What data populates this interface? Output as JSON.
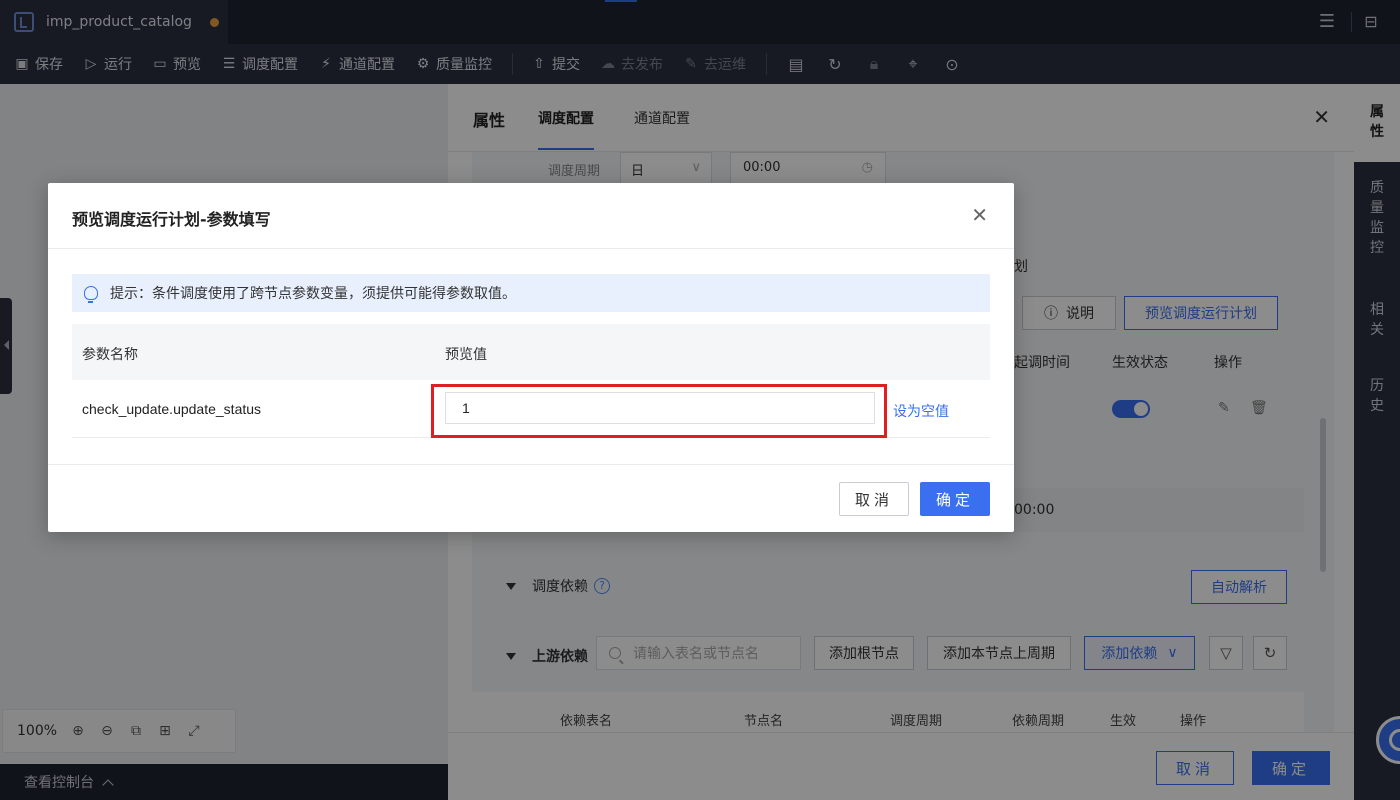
{
  "tabbar": {
    "file_name": "imp_product_catalog"
  },
  "toolbar": {
    "items": [
      {
        "label": "保存",
        "icon": "save-icon"
      },
      {
        "label": "运行",
        "icon": "play-icon"
      },
      {
        "label": "预览",
        "icon": "preview-icon"
      },
      {
        "label": "调度配置",
        "icon": "schedule-icon"
      },
      {
        "label": "通道配置",
        "icon": "channel-icon"
      },
      {
        "label": "质量监控",
        "icon": "monitor-icon"
      },
      {
        "label": "提交",
        "icon": "upload-icon"
      },
      {
        "label": "去发布",
        "icon": "cloud-icon"
      },
      {
        "label": "去运维",
        "icon": "wrench-icon"
      }
    ]
  },
  "canvas": {
    "zoom": "100%",
    "console_label": "查看控制台"
  },
  "panel": {
    "title": "属性",
    "tabs": [
      "调度配置",
      "通道配置"
    ],
    "period_label": "调度周期",
    "period_value": "日",
    "time_value": "00:00",
    "partial_text": "划",
    "explain_button": "说明",
    "preview_plan_button": "预览调度运行计划",
    "columns": [
      "起调时间",
      "生效状态",
      "操作"
    ],
    "time_value_2": "00:00",
    "dependency_section": "调度依赖",
    "auto_parse_button": "自动解析",
    "upstream_section": "上游依赖",
    "search_placeholder": "请输入表名或节点名",
    "add_root_button": "添加根节点",
    "add_prev_cycle_button": "添加本节点上周期",
    "add_dependency_button": "添加依赖",
    "table_headers": [
      "依赖表名",
      "节点名",
      "调度周期",
      "依赖周期",
      "生效",
      "操作"
    ],
    "cancel_button": "取消",
    "ok_button": "确定"
  },
  "vtabs": [
    "属性",
    "质量监控",
    "相关",
    "历史"
  ],
  "modal": {
    "title": "预览调度运行计划-参数填写",
    "tip": "提示：条件调度使用了跨节点参数变量，须提供可能得参数取值。",
    "col_name": "参数名称",
    "col_value": "预览值",
    "row": {
      "name": "check_update.update_status",
      "value": "1",
      "set_null": "设为空值"
    },
    "cancel_button": "取消",
    "ok_button": "确定"
  }
}
